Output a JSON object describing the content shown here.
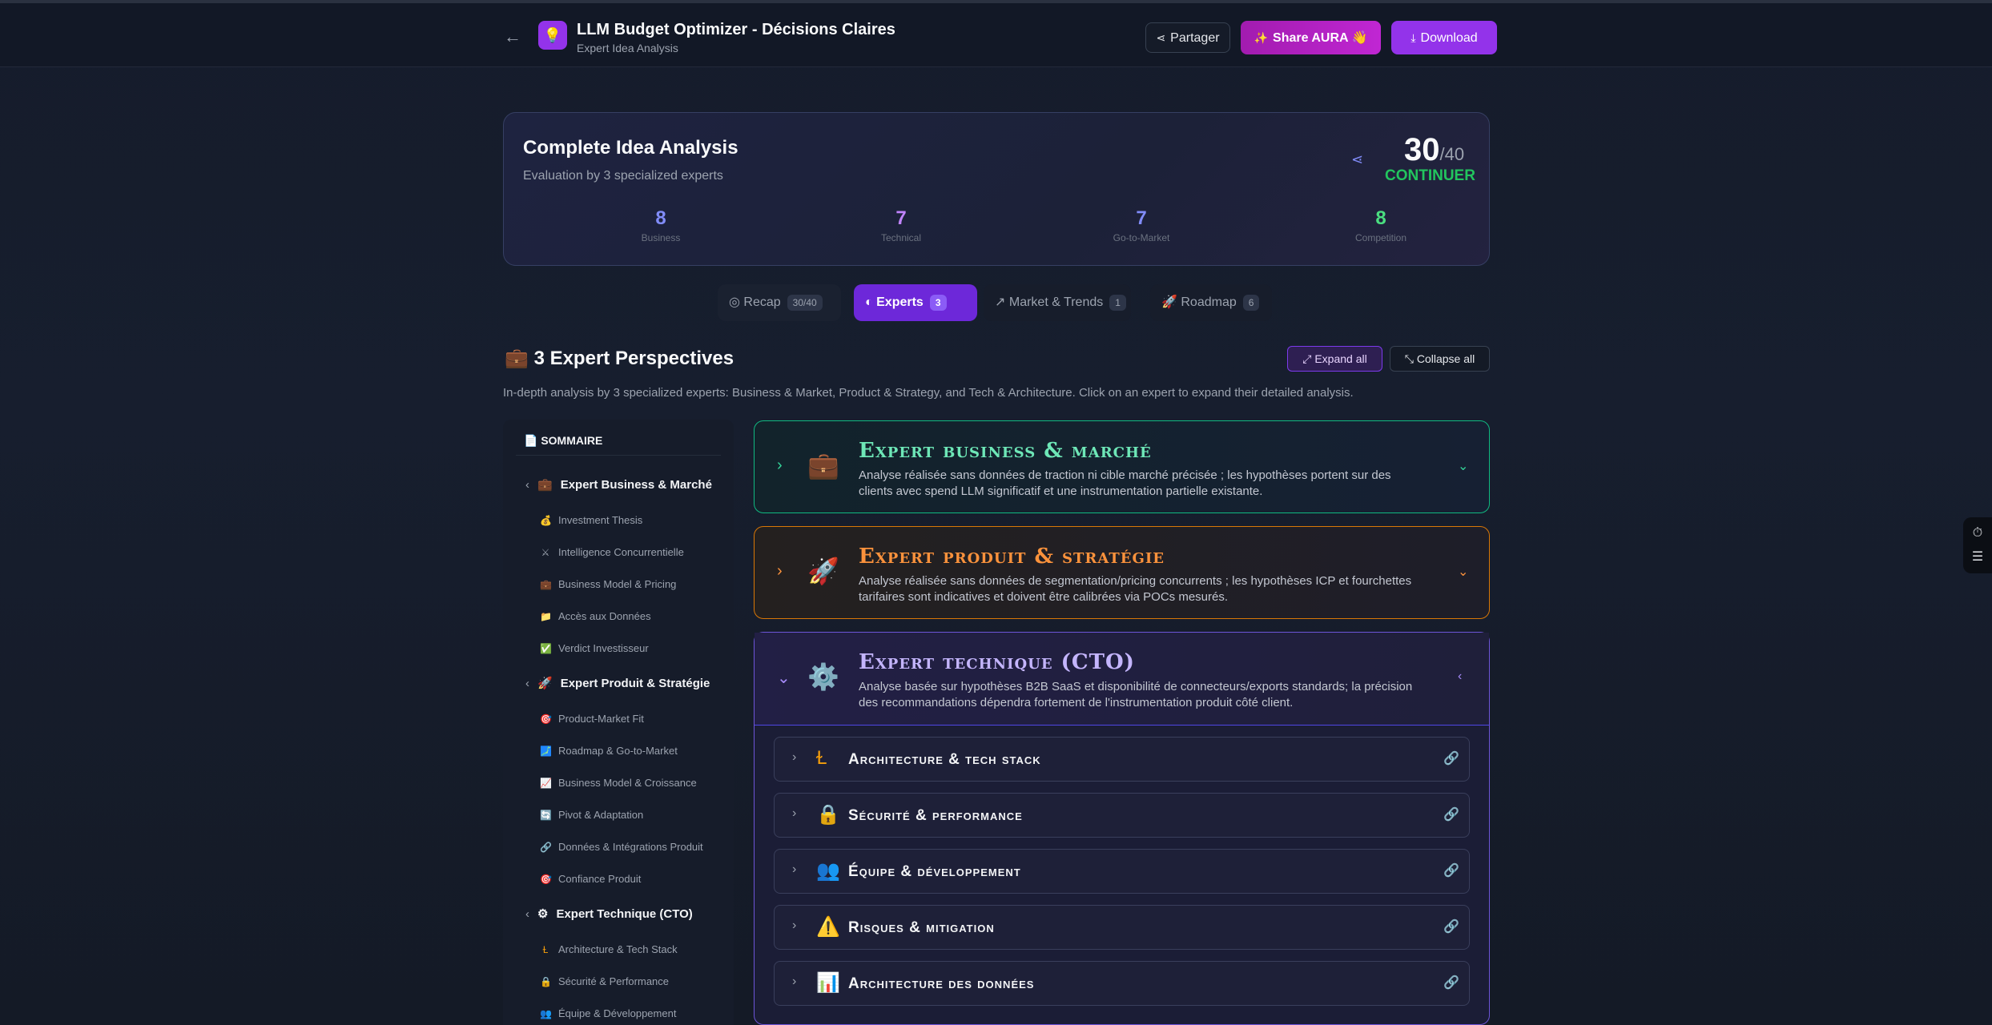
{
  "header": {
    "title": "LLM Budget Optimizer - Décisions Claires",
    "subtitle": "Expert Idea Analysis",
    "share_label": "Partager",
    "aura_label": "Share AURA",
    "download_label": "Download",
    "brand_color": "#9333ea"
  },
  "summary": {
    "title": "Complete Idea Analysis",
    "subtitle": "Evaluation by 3 specialized experts",
    "score": "30",
    "score_max": "/40",
    "verdict": "CONTINUER",
    "verdict_color": "#22c55e",
    "metrics": [
      {
        "value": "8",
        "label": "Business",
        "color": "#818cf8"
      },
      {
        "value": "7",
        "label": "Technical",
        "color": "#c084fc"
      },
      {
        "value": "7",
        "label": "Go-to-Market",
        "color": "#818cf8"
      },
      {
        "value": "8",
        "label": "Competition",
        "color": "#4ade80"
      }
    ]
  },
  "tabs": [
    {
      "label": "Recap",
      "badge": "30/40",
      "icon": "target-icon"
    },
    {
      "label": "Experts",
      "badge": "3",
      "icon": "brain-icon",
      "active": true
    },
    {
      "label": "Market & Trends",
      "badge": "1",
      "icon": "trend-icon"
    },
    {
      "label": "Roadmap",
      "badge": "6",
      "icon": "rocket-icon"
    }
  ],
  "section": {
    "title": "3 Expert Perspectives",
    "expand_all": "Expand all",
    "collapse_all": "Collapse all",
    "description": "In-depth analysis by 3 specialized experts: Business & Market, Product & Strategy, and Tech & Architecture. Click on an expert to expand their detailed analysis."
  },
  "sidebar": {
    "heading": "SOMMAIRE",
    "groups": [
      {
        "label": "Expert Business & Marché",
        "icon": "briefcase-icon",
        "items": [
          "Investment Thesis",
          "Intelligence Concurrentielle",
          "Business Model & Pricing",
          "Accès aux Données",
          "Verdict Investisseur"
        ]
      },
      {
        "label": "Expert Produit & Stratégie",
        "icon": "rocket-icon",
        "items": [
          "Product-Market Fit",
          "Roadmap & Go-to-Market",
          "Business Model & Croissance",
          "Pivot & Adaptation",
          "Données & Intégrations Produit",
          "Confiance Produit"
        ]
      },
      {
        "label": "Expert Technique (CTO)",
        "icon": "gear-icon",
        "items": [
          "Architecture & Tech Stack",
          "Sécurité & Performance",
          "Équipe & Développement"
        ]
      }
    ]
  },
  "experts": [
    {
      "name": "Expert business & marché",
      "color": "#6ee7b7",
      "description": "Analyse réalisée sans données de traction ni cible marché précisée ; les hypothèses portent sur des clients avec spend LLM significatif et une instrumentation partielle existante."
    },
    {
      "name": "Expert produit & stratégie",
      "color": "#fb923c",
      "description": "Analyse réalisée sans données de segmentation/pricing concurrents ; les hypothèses ICP et fourchettes tarifaires sont indicatives et doivent être calibrées via POCs mesurés."
    },
    {
      "name": "Expert technique (CTO)",
      "color": "#c4b5fd",
      "description": "Analyse basée sur hypothèses B2B SaaS et disponibilité de connecteurs/exports standards; la précision des recommandations dépendra fortement de l'instrumentation produit côté client.",
      "sections": [
        {
          "label": "Architecture & tech stack",
          "icon": "ladder-icon"
        },
        {
          "label": "Sécurité & performance",
          "icon": "lock-icon"
        },
        {
          "label": "Équipe & développement",
          "icon": "team-icon"
        },
        {
          "label": "Risques & mitigation",
          "icon": "warning-icon"
        },
        {
          "label": "Architecture des données",
          "icon": "bar-chart-icon"
        }
      ]
    }
  ]
}
